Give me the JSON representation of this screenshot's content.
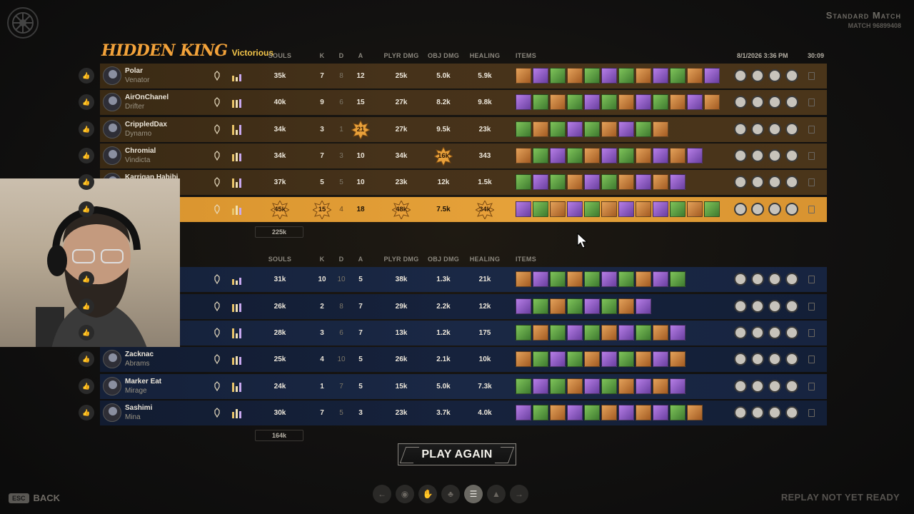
{
  "match": {
    "title": "Standard Match",
    "id": "MATCH 96899408"
  },
  "team": {
    "name": "HIDDEN KING",
    "result": "Victorious"
  },
  "columns": {
    "souls": "SOULS",
    "k": "K",
    "d": "D",
    "a": "A",
    "plyr_dmg": "PLYR DMG",
    "obj_dmg": "OBJ DMG",
    "healing": "HEALING",
    "items": "ITEMS"
  },
  "datetime": "8/1/2026 3:36 PM",
  "duration": "30:09",
  "team1": {
    "players": [
      {
        "name": "Polar",
        "hero": "Venator",
        "souls": "35k",
        "k": "7",
        "d": "8",
        "a": "12",
        "plyr_dmg": "25k",
        "obj_dmg": "5.0k",
        "healing": "5.9k",
        "items": 12
      },
      {
        "name": "AirOnChanel",
        "hero": "Drifter",
        "souls": "40k",
        "k": "9",
        "d": "6",
        "a": "15",
        "plyr_dmg": "27k",
        "obj_dmg": "8.2k",
        "healing": "9.8k",
        "items": 12
      },
      {
        "name": "CrippledDax",
        "hero": "Dynamo",
        "souls": "34k",
        "k": "3",
        "d": "1",
        "a": "21",
        "plyr_dmg": "27k",
        "obj_dmg": "9.5k",
        "healing": "23k",
        "items": 9
      },
      {
        "name": "Chromial",
        "hero": "Vindicta",
        "souls": "34k",
        "k": "7",
        "d": "3",
        "a": "10",
        "plyr_dmg": "34k",
        "obj_dmg": "16k",
        "healing": "343",
        "items": 11
      },
      {
        "name": "Karrigan Habibi",
        "hero": "",
        "souls": "37k",
        "k": "5",
        "d": "5",
        "a": "10",
        "plyr_dmg": "23k",
        "obj_dmg": "12k",
        "healing": "1.5k",
        "items": 10
      },
      {
        "name": "",
        "hero": "",
        "souls": "45k",
        "k": "15",
        "d": "4",
        "a": "18",
        "plyr_dmg": "48k",
        "obj_dmg": "7.5k",
        "healing": "34k",
        "items": 12
      }
    ],
    "total_souls": "225k"
  },
  "team2": {
    "players": [
      {
        "name": "",
        "hero": "",
        "souls": "31k",
        "k": "10",
        "d": "10",
        "a": "5",
        "plyr_dmg": "38k",
        "obj_dmg": "1.3k",
        "healing": "21k",
        "items": 10
      },
      {
        "name": "",
        "hero": "",
        "souls": "26k",
        "k": "2",
        "d": "8",
        "a": "7",
        "plyr_dmg": "29k",
        "obj_dmg": "2.2k",
        "healing": "12k",
        "items": 8
      },
      {
        "name": "",
        "hero": "",
        "souls": "28k",
        "k": "3",
        "d": "6",
        "a": "7",
        "plyr_dmg": "13k",
        "obj_dmg": "1.2k",
        "healing": "175",
        "items": 10
      },
      {
        "name": "Zacknac",
        "hero": "Abrams",
        "souls": "25k",
        "k": "4",
        "d": "10",
        "a": "5",
        "plyr_dmg": "26k",
        "obj_dmg": "2.1k",
        "healing": "10k",
        "items": 10
      },
      {
        "name": "Marker Eat",
        "hero": "Mirage",
        "souls": "24k",
        "k": "1",
        "d": "7",
        "a": "5",
        "plyr_dmg": "15k",
        "obj_dmg": "5.0k",
        "healing": "7.3k",
        "items": 10
      },
      {
        "name": "Sashimi",
        "hero": "Mina",
        "souls": "30k",
        "k": "7",
        "d": "5",
        "a": "3",
        "plyr_dmg": "23k",
        "obj_dmg": "3.7k",
        "healing": "4.0k",
        "items": 11
      }
    ],
    "total_souls": "164k"
  },
  "play_again": "PLAY AGAIN",
  "back": {
    "key": "ESC",
    "label": "BACK"
  },
  "replay_status": "REPLAY NOT YET READY",
  "colors": {
    "team1": "#46321a",
    "highlight": "#e6a23a",
    "team2": "#1a2845",
    "gold": "#f2a23a"
  }
}
